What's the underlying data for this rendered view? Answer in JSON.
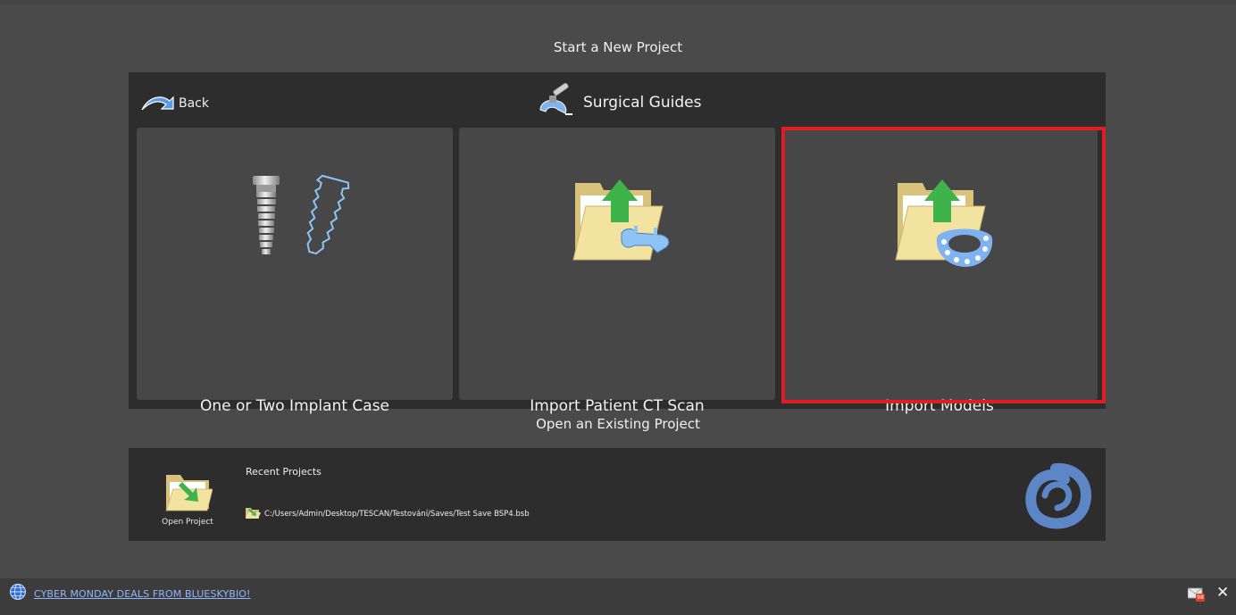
{
  "new_section": {
    "title": "Start a New Project"
  },
  "panel": {
    "back_label": "Back",
    "title": "Surgical Guides",
    "tiles": [
      {
        "label": "One or Two Implant Case",
        "icon": "dental-implant-icon"
      },
      {
        "label": "Import Patient CT Scan",
        "icon": "import-ct-folder-icon"
      },
      {
        "label": "Import Models",
        "icon": "import-models-folder-icon",
        "highlighted": true
      }
    ]
  },
  "open_section": {
    "title": "Open an Existing Project",
    "open_label": "Open Project",
    "recent_title": "Recent Projects",
    "recent_items": [
      {
        "path": "C:/Users/Admin/Desktop/TESCAN/Testování/Saves/Test Save BSP4.bsb"
      }
    ]
  },
  "status_bar": {
    "promo_text": "CYBER MONDAY DEALS FROM BLUESKYBIO!",
    "mail_count": "98"
  },
  "colors": {
    "background": "#4a4a4a",
    "panel": "#2d2d2d",
    "tile": "#474747",
    "highlight": "#e01c24",
    "link": "#8fb6ff"
  }
}
